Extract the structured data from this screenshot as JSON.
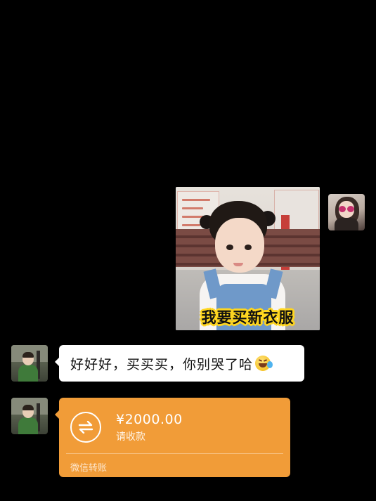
{
  "sticker": {
    "caption": "我要买新衣服"
  },
  "text_message": {
    "content": "好好好，买买买，你别哭了哈",
    "emoji": "laughing-crying-emoji"
  },
  "transfer": {
    "amount": "¥2000.00",
    "subtitle": "请收款",
    "footer": "微信转账",
    "icon": "transfer-arrows-icon"
  },
  "colors": {
    "background": "#000000",
    "transfer_bubble": "#f19c38",
    "text_bubble": "#ffffff",
    "caption_stroke": "#ffd61f"
  }
}
